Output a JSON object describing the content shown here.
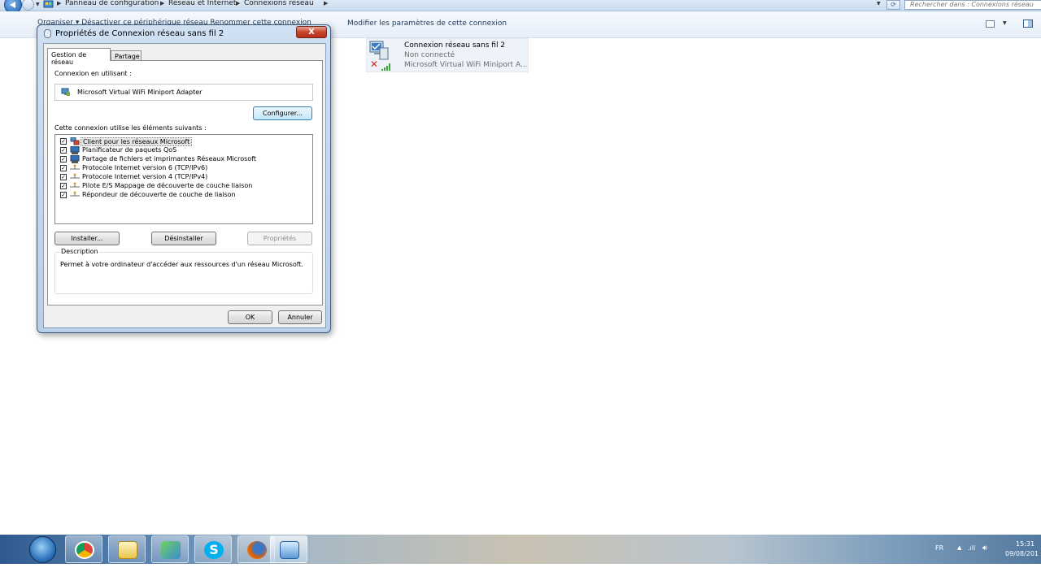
{
  "explorer": {
    "breadcrumb": [
      "Panneau de configuration",
      "Réseau et Internet",
      "Connexions réseau"
    ],
    "search_placeholder": "Rechercher dans : Connexions réseau",
    "command_bar": {
      "organize": "Organiser ▾   Désactiver ce périphérique réseau    Renommer cette connexion",
      "modify": "Modifier les paramètres de cette connexion"
    }
  },
  "connection": {
    "name": "Connexion réseau sans fil 2",
    "status": "Non connecté",
    "adapter": "Microsoft Virtual WiFi Miniport A..."
  },
  "dialog": {
    "title": "Propriétés de Connexion réseau sans fil 2",
    "close": "X",
    "tabs": [
      "Gestion de réseau",
      "Partage"
    ],
    "connect_using_label": "Connexion en utilisant :",
    "adapter_name": "Microsoft Virtual WiFi Miniport Adapter",
    "configure_button": "Configurer...",
    "items_label": "Cette connexion utilise les éléments suivants :",
    "items": [
      {
        "label": "Client pour les réseaux Microsoft",
        "checked": true,
        "icon": "network-client-icon"
      },
      {
        "label": "Planificateur de paquets QoS",
        "checked": true,
        "icon": "qos-icon"
      },
      {
        "label": "Partage de fichiers et imprimantes Réseaux Microsoft",
        "checked": true,
        "icon": "file-sharing-icon"
      },
      {
        "label": "Protocole Internet version 6 (TCP/IPv6)",
        "checked": true,
        "icon": "protocol-icon"
      },
      {
        "label": "Protocole Internet version 4 (TCP/IPv4)",
        "checked": true,
        "icon": "protocol-icon"
      },
      {
        "label": "Pilote E/S Mappage de découverte de couche liaison",
        "checked": true,
        "icon": "protocol-icon"
      },
      {
        "label": "Répondeur de découverte de couche de liaison",
        "checked": true,
        "icon": "protocol-icon"
      }
    ],
    "install_button": "Installer...",
    "uninstall_button": "Désinstaller",
    "properties_button": "Propriétés",
    "description_legend": "Description",
    "description_text": "Permet à votre ordinateur d'accéder aux ressources d'un réseau Microsoft.",
    "ok_button": "OK",
    "cancel_button": "Annuler"
  },
  "tray": {
    "language": "FR",
    "time": "15:31",
    "date": "09/08/201"
  }
}
